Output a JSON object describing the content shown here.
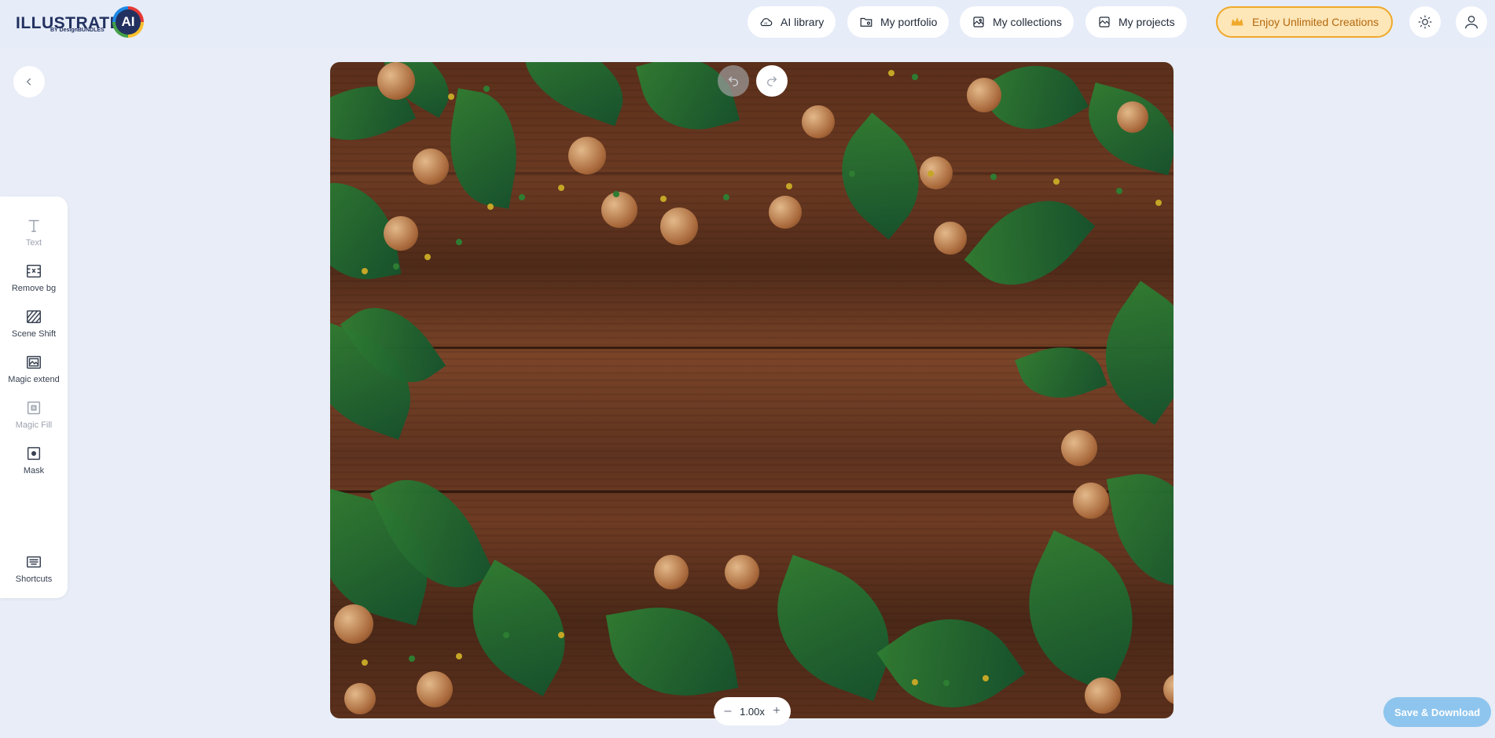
{
  "app": {
    "logo_text": "ILLUSTRATE",
    "logo_badge": "AI",
    "logo_sub": "BY DesignBUNDLES"
  },
  "nav": {
    "items": [
      {
        "label": "AI library",
        "icon": "cloud-ai-icon"
      },
      {
        "label": "My portfolio",
        "icon": "portfolio-icon"
      },
      {
        "label": "My collections",
        "icon": "collections-icon"
      },
      {
        "label": "My projects",
        "icon": "projects-icon"
      }
    ],
    "premium_label": "Enjoy Unlimited Creations",
    "premium_icon": "crown-icon",
    "theme_icon": "sun-icon",
    "account_icon": "user-icon"
  },
  "tools": {
    "items": [
      {
        "label": "Text",
        "icon": "text-icon",
        "disabled": true
      },
      {
        "label": "Remove bg",
        "icon": "remove-bg-icon",
        "disabled": false
      },
      {
        "label": "Scene Shift",
        "icon": "scene-shift-icon",
        "disabled": false
      },
      {
        "label": "Magic extend",
        "icon": "magic-extend-icon",
        "disabled": false
      },
      {
        "label": "Magic Fill",
        "icon": "magic-fill-icon",
        "disabled": true
      },
      {
        "label": "Mask",
        "icon": "mask-icon",
        "disabled": false
      },
      {
        "label": "Shortcuts",
        "icon": "keyboard-icon",
        "disabled": false
      }
    ]
  },
  "canvas": {
    "zoom": "1.00x",
    "zoom_out": "–",
    "zoom_in": "+"
  },
  "actions": {
    "save_label": "Save & Download"
  },
  "colors": {
    "background": "#e8edf7",
    "premium_border": "#f0a92a",
    "premium_text": "#b4690e",
    "save_button": "#8ec5ee"
  }
}
